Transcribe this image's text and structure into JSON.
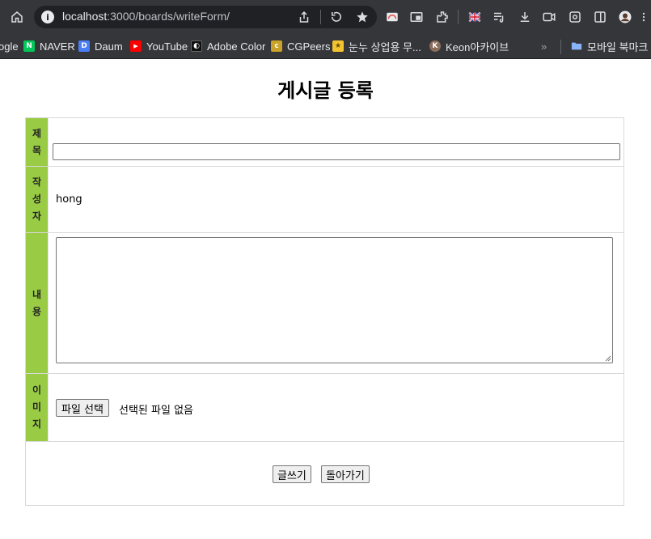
{
  "browser": {
    "url_host": "localhost",
    "url_rest": ":3000/boards/writeForm/",
    "info_icon": "i"
  },
  "bookmarks": [
    {
      "label": "ogle",
      "icon": "google-icon",
      "color": "#35363a",
      "glyph": ""
    },
    {
      "label": "NAVER",
      "icon": "naver-icon",
      "color": "#03c75a",
      "glyph": "N"
    },
    {
      "label": "Daum",
      "icon": "daum-icon",
      "color": "#4a7ef5",
      "glyph": "D"
    },
    {
      "label": "YouTube",
      "icon": "youtube-icon",
      "color": "#ff0000",
      "glyph": "▶"
    },
    {
      "label": "Adobe Color",
      "icon": "adobe-color-icon",
      "color": "#111111",
      "glyph": "◐"
    },
    {
      "label": "CGPeers",
      "icon": "cgpeers-icon",
      "color": "#c9a227",
      "glyph": "c"
    },
    {
      "label": "눈누 상업용 무...",
      "icon": "noonnu-icon",
      "color": "#f4c430",
      "glyph": "★"
    },
    {
      "label": "Keon아카이브",
      "icon": "keon-archive-icon",
      "color": "#8a6d5a",
      "glyph": "K"
    },
    {
      "label": "모바일 북마크",
      "icon": "folder-icon",
      "color": "#8ab4f8",
      "glyph": ""
    }
  ],
  "bookmarks_overflow": "»",
  "page": {
    "title": "게시글 등록"
  },
  "form": {
    "title_label": "제목",
    "writer_label": "작성자",
    "writer_value": "hong",
    "content_label": "내용",
    "image_label": "이미지",
    "file_button": "파일 선택",
    "file_status": "선택된 파일 없음",
    "submit_button": "글쓰기",
    "back_button": "돌아가기"
  },
  "colors": {
    "label_bg": "#99cc44",
    "chrome_bg": "#35363a"
  }
}
